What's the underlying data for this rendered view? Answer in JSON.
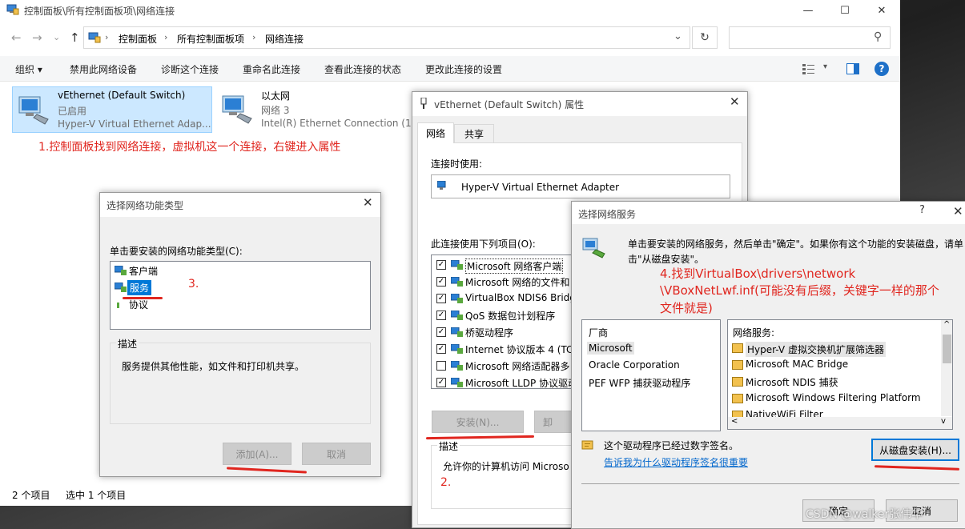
{
  "window": {
    "title": "控制面板\\所有控制面板项\\网络连接",
    "minimize": "—",
    "maximize": "☐",
    "close": "✕"
  },
  "nav": {
    "back": "←",
    "forward": "→",
    "up": "↑",
    "recent": "⌄"
  },
  "address": {
    "crumbs": [
      "控制面板",
      "所有控制面板项",
      "网络连接"
    ],
    "sep": "›",
    "dropdown": "⌄",
    "refresh": "↻"
  },
  "search": {
    "placeholder": "",
    "icon": "⚲"
  },
  "toolbar": {
    "organize": "组织 ▾",
    "items": [
      "禁用此网络设备",
      "诊断这个连接",
      "重命名此连接",
      "查看此连接的状态",
      "更改此连接的设置"
    ],
    "help": "?"
  },
  "adapters": [
    {
      "name": "vEthernet (Default Switch)",
      "status": "已启用",
      "device": "Hyper-V Virtual Ethernet Adap..."
    },
    {
      "name": "以太网",
      "status": "网络 3",
      "device": "Intel(R) Ethernet Connection (1..."
    }
  ],
  "annotations": {
    "step1": "1.控制面板找到网络连接，虚拟机这一个连接，右键进入属性",
    "step2": "2.",
    "step3": "3.",
    "step4_line1": "4.找到VirtualBox\\drivers\\network",
    "step4_line2": "\\VBoxNetLwf.inf(可能没有后缀，关键字一样的那个",
    "step4_line3": "文件就是)"
  },
  "status": {
    "count": "2 个项目",
    "selected": "选中 1 个项目"
  },
  "feature_dialog": {
    "title": "选择网络功能类型",
    "close": "✕",
    "prompt": "单击要安装的网络功能类型(C):",
    "items": [
      "客户端",
      "服务",
      "协议"
    ],
    "desc_title": "描述",
    "desc_text": "服务提供其他性能，如文件和打印机共享。",
    "add_label": "添加(A)...",
    "cancel_label": "取消"
  },
  "props_dialog": {
    "title": "vEthernet (Default Switch) 属性",
    "close": "✕",
    "tabs": [
      "网络",
      "共享"
    ],
    "connect_using": "连接时使用:",
    "adapter": "Hyper-V Virtual Ethernet Adapter",
    "items_label": "此连接使用下列项目(O):",
    "items": [
      {
        "label": "Microsoft 网络客户端",
        "checked": true
      },
      {
        "label": "Microsoft 网络的文件和",
        "checked": true
      },
      {
        "label": "VirtualBox NDIS6 Bridg",
        "checked": true
      },
      {
        "label": "QoS 数据包计划程序",
        "checked": true
      },
      {
        "label": "桥驱动程序",
        "checked": true
      },
      {
        "label": "Internet 协议版本 4 (TC",
        "checked": true
      },
      {
        "label": "Microsoft 网络适配器多",
        "checked": false
      },
      {
        "label": "Microsoft LLDP 协议驱动",
        "checked": true
      }
    ],
    "check": "✓",
    "install_label": "安装(N)...",
    "uninstall_label": "卸",
    "desc_title": "描述",
    "desc_text": "允许你的计算机访问 Microso"
  },
  "service_dialog": {
    "title": "选择网络服务",
    "help": "?",
    "close": "✕",
    "prompt_line1": "单击要安装的网络服务，然后单击\"确定\"。如果你有这个功能的安装磁盘，请单",
    "prompt_line2": "击\"从磁盘安装\"。",
    "vendor_header": "厂商",
    "vendors": [
      "Microsoft",
      "Oracle Corporation",
      "PEF WFP 捕获驱动程序"
    ],
    "service_header": "网络服务:",
    "services": [
      "Hyper-V 虚拟交换机扩展筛选器",
      "Microsoft MAC Bridge",
      "Microsoft NDIS 捕获",
      "Microsoft Windows Filtering Platform",
      "NativeWiFi Filter"
    ],
    "scroll_up": "^",
    "scroll_down": "v",
    "signed_text": "这个驱动程序已经过数字签名。",
    "signed_link": "告诉我为什么驱动程序签名很重要",
    "disk_label": "从磁盘安装(H)...",
    "ok_label": "确定",
    "cancel_label": "取消"
  },
  "watermark": "CSDN @walker张伟华"
}
